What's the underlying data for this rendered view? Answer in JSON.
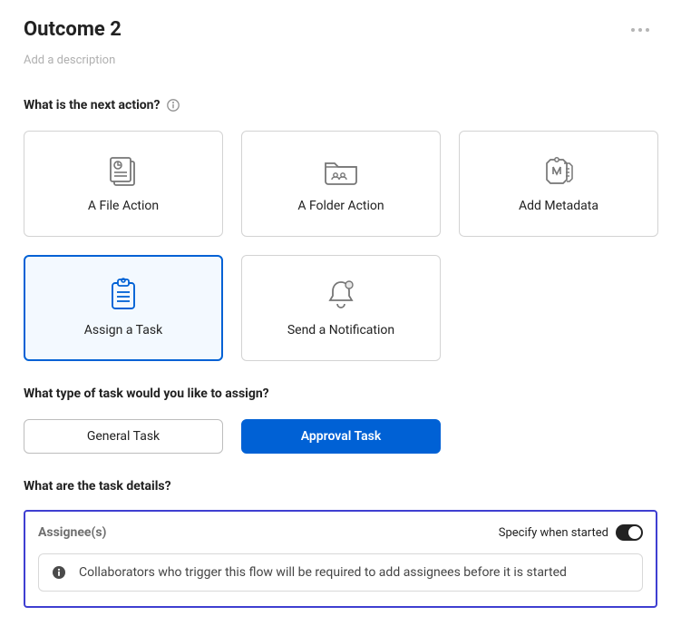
{
  "header": {
    "title": "Outcome 2",
    "description_placeholder": "Add a description"
  },
  "next_action": {
    "label": "What is the next action?",
    "options": {
      "file": {
        "label": "A File Action"
      },
      "folder": {
        "label": "A Folder Action"
      },
      "meta": {
        "label": "Add Metadata"
      },
      "task": {
        "label": "Assign a Task"
      },
      "notify": {
        "label": "Send a Notification"
      }
    },
    "selected": "task"
  },
  "task_type": {
    "label": "What type of task would you like to assign?",
    "general": "General Task",
    "approval": "Approval Task",
    "selected": "approval"
  },
  "task_details": {
    "label": "What are the task details?",
    "assignee_label": "Assignee(s)",
    "specify_label": "Specify when started",
    "banner": "Collaborators who trigger this flow will be required to add assignees before it is started"
  }
}
